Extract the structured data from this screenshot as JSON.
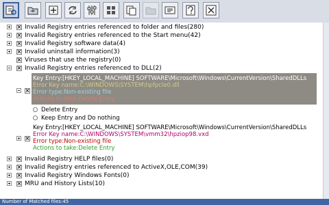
{
  "toolbar": {
    "buttons": [
      {
        "icon": "registry-scan-icon"
      },
      {
        "icon": "folder-scan-icon"
      },
      {
        "icon": "add-item-icon"
      },
      {
        "icon": "refresh-icon"
      },
      {
        "icon": "sliders-icon"
      },
      {
        "icon": "windows-flag-icon"
      },
      {
        "icon": "copy-icon"
      },
      {
        "icon": "folder-icon"
      },
      {
        "icon": "id-card-icon"
      },
      {
        "icon": "help-icon"
      },
      {
        "icon": "close-box-icon"
      }
    ]
  },
  "tree": {
    "top_items": [
      {
        "label": "Invalid Registry entries referenced to folder and files(280)",
        "expander": "plus"
      },
      {
        "label": "Invalid Registry entries referenced to the Start menu(42)",
        "expander": "plus"
      },
      {
        "label": "Invalid Registry software data(4)",
        "expander": "plus"
      },
      {
        "label": "Invalid uninstall information(3)",
        "expander": "plus"
      },
      {
        "label": "Viruses that use the registry(0)",
        "expander": "none"
      },
      {
        "label": "Invalid Registry entries referenced to DLL(2)",
        "expander": "minus"
      }
    ],
    "entry1": {
      "key": "Key Entry:[HKEY_LOCAL_MACHINE] SOFTWARE\\Microsoft\\Windows\\CurrentVersion\\SharedDLLs",
      "error_key": "Error Key name:C:\\WINDOWS\\SYSTEM\\hpfpcle0.dll",
      "error_type": "Error type:Non-existing file",
      "action": "Actions to take:Delete Entry",
      "options": [
        "Delete Entry",
        "Keep Entry and Do nothing"
      ]
    },
    "entry2": {
      "key": "Key Entry:[HKEY_LOCAL_MACHINE] SOFTWARE\\Microsoft\\Windows\\CurrentVersion\\SharedDLLs",
      "error_key": "Error Key name:C:\\WINDOWS\\SYSTEM\\vmm32\\hpziop98.vxd",
      "error_type": "Error type:Non-existing file",
      "action": "Actions to take:Delete Entry"
    },
    "bottom_items": [
      {
        "label": "Invalid Registry HELP files(0)"
      },
      {
        "label": "Invalid Registry entries referenced to ActiveX,OLE,COM(39)"
      },
      {
        "label": "Invalid Registry Windows Fonts(0)"
      },
      {
        "label": "MRU and History Lists(10)"
      }
    ]
  },
  "status": {
    "text": "Number of Matched files:45"
  },
  "colors": {
    "selected_key": "#ffffff",
    "selected_error_key": "#d4c98a",
    "selected_error_type": "#9fd3e6",
    "selected_action": "#e07a6a",
    "error_key": "#b0006a",
    "error_type": "#c40000",
    "action": "#2f9a2f",
    "status_bar": "#3f66a3"
  }
}
